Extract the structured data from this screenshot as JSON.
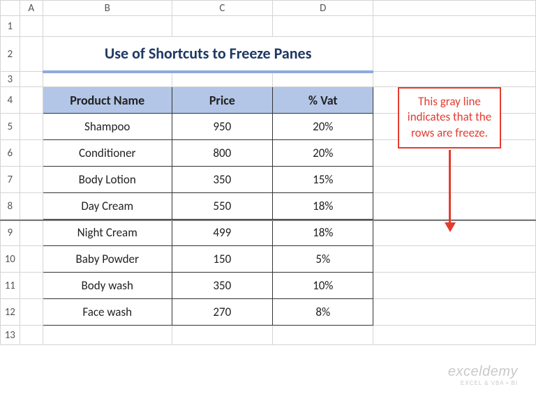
{
  "columns": {
    "A": "A",
    "B": "B",
    "C": "C",
    "D": "D"
  },
  "rows": [
    "1",
    "2",
    "3",
    "4",
    "5",
    "6",
    "7",
    "8",
    "9",
    "10",
    "11",
    "12",
    "13"
  ],
  "title": "Use of Shortcuts to Freeze Panes",
  "headers": {
    "product": "Product Name",
    "price": "Price",
    "vat": "% Vat"
  },
  "data": [
    {
      "product": "Shampoo",
      "price": "950",
      "vat": "20%"
    },
    {
      "product": "Conditioner",
      "price": "800",
      "vat": "20%"
    },
    {
      "product": "Body Lotion",
      "price": "350",
      "vat": "15%"
    },
    {
      "product": "Day Cream",
      "price": "550",
      "vat": "18%"
    },
    {
      "product": "Night Cream",
      "price": "499",
      "vat": "18%"
    },
    {
      "product": "Baby Powder",
      "price": "150",
      "vat": "5%"
    },
    {
      "product": "Body wash",
      "price": "350",
      "vat": "10%"
    },
    {
      "product": "Face wash",
      "price": "270",
      "vat": "8%"
    }
  ],
  "callout": "This gray line indicates that the rows are freeze.",
  "watermark": {
    "line1": "exceldemy",
    "line2": "EXCEL & VBA • BI"
  },
  "chart_data": {
    "type": "table",
    "title": "Use of Shortcuts to Freeze Panes",
    "columns": [
      "Product Name",
      "Price",
      "% Vat"
    ],
    "rows": [
      [
        "Shampoo",
        950,
        "20%"
      ],
      [
        "Conditioner",
        800,
        "20%"
      ],
      [
        "Body Lotion",
        350,
        "15%"
      ],
      [
        "Day Cream",
        550,
        "18%"
      ],
      [
        "Night Cream",
        499,
        "18%"
      ],
      [
        "Baby Powder",
        150,
        "5%"
      ],
      [
        "Body wash",
        350,
        "10%"
      ],
      [
        "Face wash",
        270,
        "8%"
      ]
    ]
  }
}
